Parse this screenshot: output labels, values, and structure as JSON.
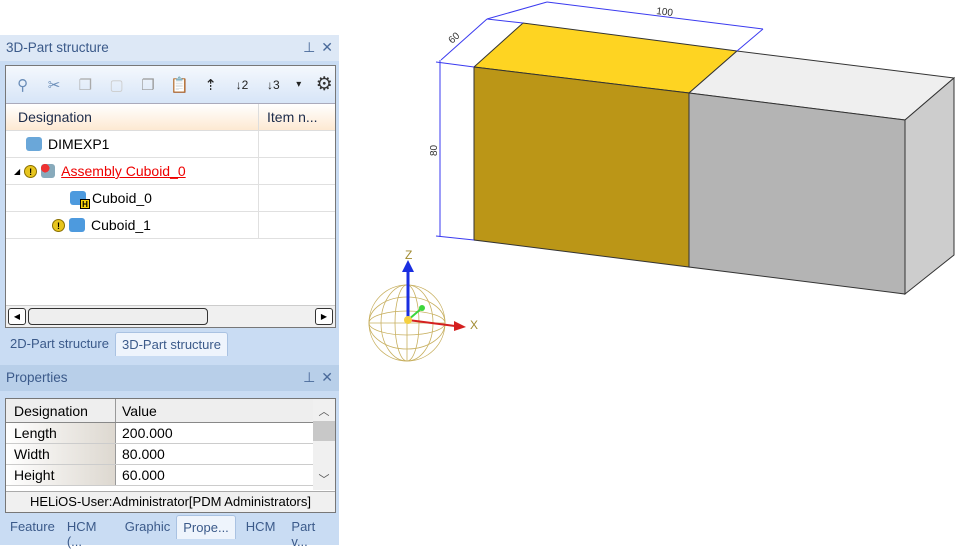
{
  "part_panel": {
    "title": "3D-Part structure",
    "pin": "⊥",
    "close": "✕",
    "toolbar": [
      {
        "name": "zoom-find",
        "glyph": "⚲"
      },
      {
        "name": "cut",
        "glyph": "✂"
      },
      {
        "name": "copy",
        "glyph": "❐"
      },
      {
        "name": "paste-disabled",
        "glyph": "▢"
      },
      {
        "name": "paste-as",
        "glyph": "❐"
      },
      {
        "name": "paste-special",
        "glyph": "📋"
      },
      {
        "name": "level-up",
        "glyph": "⇡"
      },
      {
        "name": "level-2",
        "glyph": "↓2"
      },
      {
        "name": "level-3",
        "glyph": "↓3"
      },
      {
        "name": "more",
        "glyph": "▾"
      },
      {
        "name": "settings",
        "glyph": "⚙"
      }
    ],
    "columns": [
      "Designation",
      "Item n..."
    ],
    "rows": [
      {
        "label": "DIMEXP1"
      },
      {
        "label": "Assembly Cuboid_0",
        "expander": "◢"
      },
      {
        "label": "Cuboid_0",
        "badge": "H"
      },
      {
        "label": "Cuboid_1"
      }
    ],
    "warn": "!"
  },
  "bottom_tabs": [
    "2D-Part structure",
    "3D-Part structure"
  ],
  "properties": {
    "title": "Properties",
    "columns": [
      "Designation",
      "Value"
    ],
    "rows": [
      {
        "key": "Length",
        "value": "200.000"
      },
      {
        "key": "Width",
        "value": "80.000"
      },
      {
        "key": "Height",
        "value": "60.000"
      }
    ],
    "status": "HELiOS-User:Administrator[PDM Administrators]"
  },
  "lower_tabs": [
    "Feature",
    "HCM (...",
    "Graphic",
    "Prope...",
    "HCM",
    "Part v..."
  ],
  "viewport": {
    "dims": {
      "width": "100",
      "depth": "60",
      "height": "80"
    },
    "axes": {
      "z": "Z",
      "x": "X"
    },
    "colors": {
      "selected_front": "#bb9617",
      "selected_top": "#fed422",
      "front": "#b4b4b4",
      "top": "#efefef",
      "side": "#cdcdcd",
      "dim": "#3a3af0"
    }
  }
}
